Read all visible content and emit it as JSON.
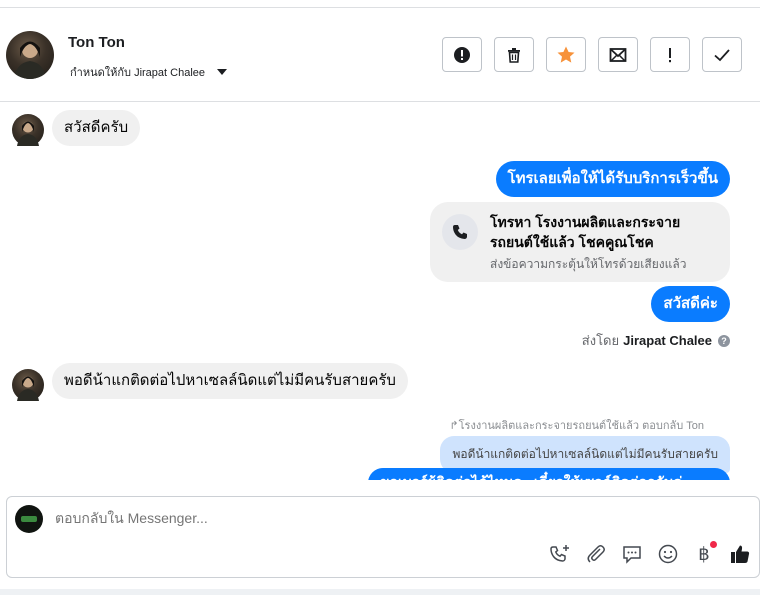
{
  "header": {
    "contact_name": "Ton Ton",
    "assigned_to": "กำหนดให้กับ Jirapat Chalee",
    "actions": [
      {
        "name": "spam-button",
        "icon": "alert-circle-icon"
      },
      {
        "name": "delete-button",
        "icon": "trash-icon"
      },
      {
        "name": "star-button",
        "icon": "star-icon"
      },
      {
        "name": "mark-unread-button",
        "icon": "envelope-icon"
      },
      {
        "name": "important-button",
        "icon": "exclamation-icon"
      },
      {
        "name": "done-button",
        "icon": "check-icon"
      }
    ]
  },
  "thread": {
    "msg1": "สวัสดีครับ",
    "msg2": "โทรเลยเพื่อให้ได้รับบริการเร็วขึ้น",
    "call_card": {
      "title": "โทรหา โรงงานผลิตและกระจายรถยนต์ใช้แล้ว โชคคูณโชค",
      "subtitle": "ส่งข้อความกระตุ้นให้โทรด้วยเสียงแล้ว"
    },
    "msg3": "สวัสดีค่ะ",
    "sent_by_prefix": "ส่งโดย",
    "sent_by_name": "Jirapat Chalee",
    "help_mark": "?",
    "msg4": "พอดีน้าแกติดต่อไปหาเซลล์นิดแต่ไม่มีคนรับสายครับ",
    "replied_note": "↱โรงงานผลิตและกระจายรถยนต์ใช้แล้ว ตอบกลับ Ton",
    "quoted_text": "พอดีน้าแกติดต่อไปหาเซลล์นิดแต่ไม่มีคนรับสายครับ",
    "partial_reply": "ขอเบอร์ผู้ติดต่อได้ไหมคะ เดี๋ยวให้เซลล์ติดต่อกลับค่ะ"
  },
  "composer": {
    "placeholder": "ตอบกลับใน Messenger...",
    "baht_symbol": "฿",
    "colors": {
      "accent": "#0a7cff",
      "star": "#f7923a",
      "like": "#1c1e21",
      "badge": "#f02849"
    }
  }
}
